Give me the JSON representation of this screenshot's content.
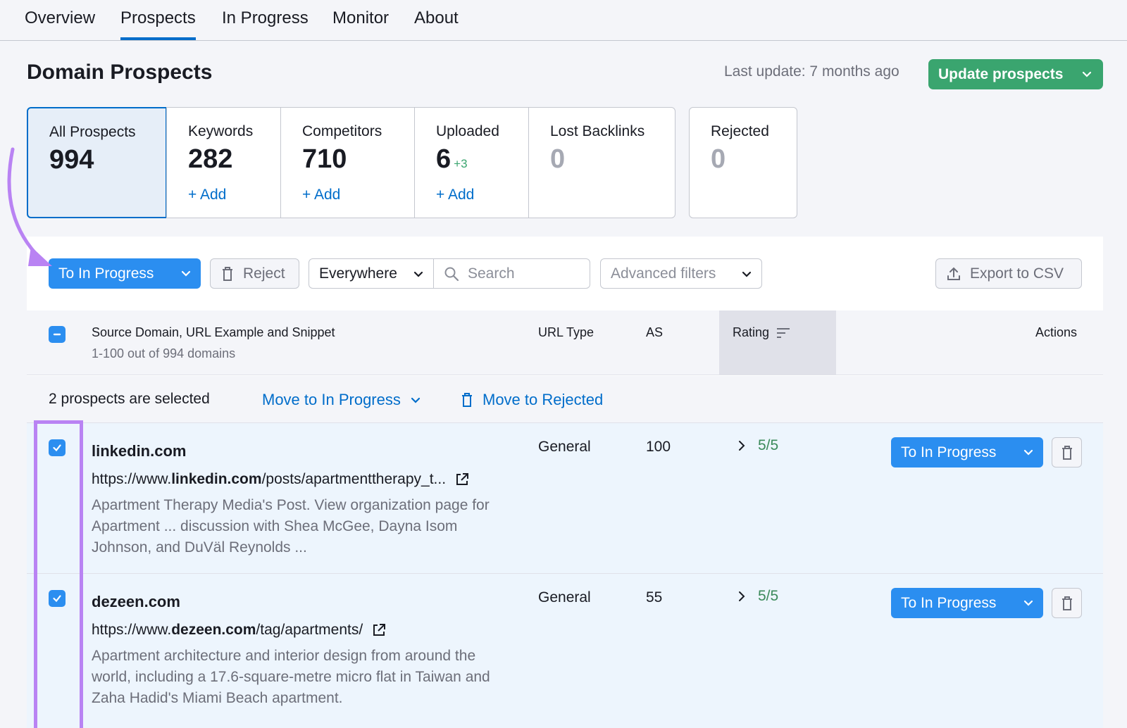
{
  "nav": {
    "tabs": [
      {
        "label": "Overview"
      },
      {
        "label": "Prospects"
      },
      {
        "label": "In Progress"
      },
      {
        "label": "Monitor"
      },
      {
        "label": "About"
      }
    ]
  },
  "header": {
    "title": "Domain Prospects",
    "last_update": "Last update: 7 months ago",
    "update_button": "Update prospects"
  },
  "cards": [
    {
      "label": "All Prospects",
      "value": "994",
      "add": ""
    },
    {
      "label": "Keywords",
      "value": "282",
      "add": "+ Add"
    },
    {
      "label": "Competitors",
      "value": "710",
      "add": "+ Add"
    },
    {
      "label": "Uploaded",
      "value": "6",
      "delta": "+3",
      "add": "+ Add"
    },
    {
      "label": "Lost Backlinks",
      "value": "0",
      "add": ""
    },
    {
      "label": "Rejected",
      "value": "0",
      "add": ""
    }
  ],
  "toolbar": {
    "to_in_progress": "To In Progress",
    "reject": "Reject",
    "scope_select": "Everywhere",
    "search_placeholder": "Search",
    "advanced_filters": "Advanced filters",
    "export": "Export to CSV"
  },
  "table": {
    "headers": {
      "source": "Source Domain, URL Example and Snippet",
      "count": "1-100 out of 994 domains",
      "url_type": "URL Type",
      "as": "AS",
      "rating": "Rating",
      "actions": "Actions"
    },
    "selection": {
      "text": "2 prospects are selected",
      "move_in_progress": "Move to In Progress",
      "move_rejected": "Move to Rejected"
    },
    "rows": [
      {
        "domain": "linkedin.com",
        "url_prefix": "https://www.",
        "url_domain": "linkedin.com",
        "url_suffix": "/posts/apartmenttherapy_t...",
        "snippet": "Apartment Therapy Media's Post. View organization page for Apartment ... discussion with Shea McGee, Dayna Isom Johnson, and DuVäl Reynolds ...",
        "url_type": "General",
        "as": "100",
        "rating": "5/5",
        "action": "To In Progress"
      },
      {
        "domain": "dezeen.com",
        "url_prefix": "https://www.",
        "url_domain": "dezeen.com",
        "url_suffix": "/tag/apartments/",
        "snippet": "Apartment architecture and interior design from around the world, including a 17.6-square-metre micro flat in Taiwan and Zaha Hadid's Miami Beach apartment.",
        "url_type": "General",
        "as": "55",
        "rating": "5/5",
        "action": "To In Progress"
      }
    ]
  },
  "colors": {
    "primary": "#2b8ef0",
    "success": "#3aa56f",
    "annotation": "#b983f3"
  }
}
